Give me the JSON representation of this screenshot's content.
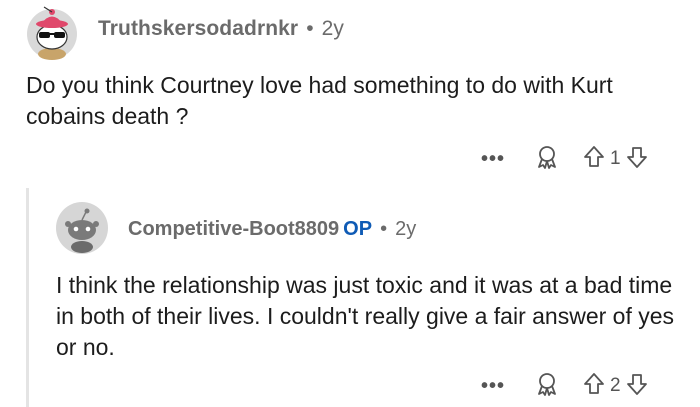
{
  "comment1": {
    "username": "Truthskersodadrnkr",
    "separator": "•",
    "age": "2y",
    "body": "Do you think Courtney love had something to do with Kurt cobains death ?",
    "more": "•••",
    "vote_count": "1"
  },
  "comment2": {
    "username": "Competitive-Boot8809",
    "op_badge": "OP",
    "separator": "•",
    "age": "2y",
    "body": "I think the relationship was just toxic and it was at a bad time in both of their lives. I couldn't really give a fair answer of yes or no.",
    "more": "•••",
    "vote_count": "2"
  },
  "icons": {
    "award": "award-icon",
    "upvote": "upvote-arrow-icon",
    "downvote": "downvote-arrow-icon",
    "more": "more-options-icon"
  },
  "colors": {
    "op_blue": "#0f5bb5",
    "meta_gray": "#6b6b6b",
    "text": "#1c1c1c"
  }
}
